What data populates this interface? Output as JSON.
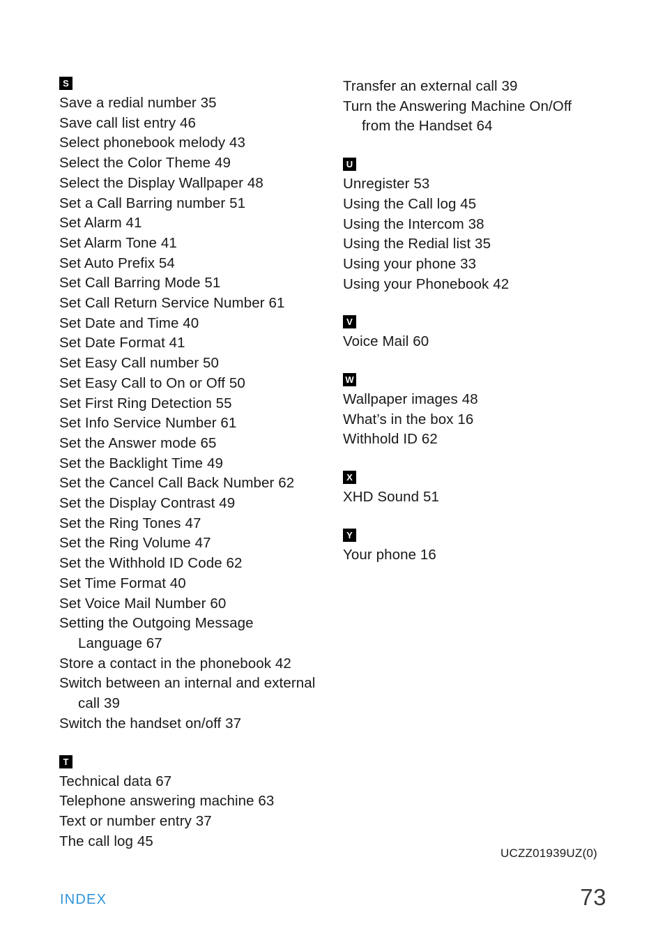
{
  "footer": {
    "section_label": "INDEX",
    "page_number": "73",
    "document_code": "UCZZ01939UZ(0)",
    "label_color": "#2f93d8"
  },
  "index": {
    "left_column": {
      "lead_entries": [],
      "sections": [
        {
          "letter": "S",
          "entries": [
            {
              "text": "Save a redial number 35"
            },
            {
              "text": "Save call list entry 46"
            },
            {
              "text": "Select phonebook melody 43"
            },
            {
              "text": "Select the Color Theme 49"
            },
            {
              "text": "Select the Display Wallpaper 48"
            },
            {
              "text": "Set a Call Barring number 51"
            },
            {
              "text": "Set Alarm 41"
            },
            {
              "text": "Set Alarm Tone 41"
            },
            {
              "text": "Set Auto Prefix 54"
            },
            {
              "text": "Set Call Barring Mode 51"
            },
            {
              "text": "Set Call Return Service Number 61"
            },
            {
              "text": "Set Date and Time 40"
            },
            {
              "text": "Set Date Format 41"
            },
            {
              "text": "Set Easy Call number 50"
            },
            {
              "text": "Set Easy Call to On or Off 50"
            },
            {
              "text": "Set First Ring Detection 55"
            },
            {
              "text": "Set Info Service Number 61"
            },
            {
              "text": "Set the Answer mode 65"
            },
            {
              "text": "Set the Backlight Time 49"
            },
            {
              "text": "Set the Cancel Call Back Number 62"
            },
            {
              "text": "Set the Display Contrast 49"
            },
            {
              "text": "Set the Ring Tones 47"
            },
            {
              "text": "Set the Ring Volume 47"
            },
            {
              "text": "Set the Withhold ID Code 62"
            },
            {
              "text": "Set Time Format 40"
            },
            {
              "text": "Set Voice Mail Number 60"
            },
            {
              "text": "Setting the Outgoing Message",
              "continuation": "Language 67"
            },
            {
              "text": "Store a contact in the phonebook 42"
            },
            {
              "text": "Switch between an internal and external",
              "continuation": "call 39"
            },
            {
              "text": "Switch the handset on/off 37"
            }
          ]
        },
        {
          "letter": "T",
          "entries": [
            {
              "text": "Technical data 67"
            },
            {
              "text": "Telephone answering machine 63"
            },
            {
              "text": "Text or number entry 37"
            },
            {
              "text": "The call log 45"
            }
          ]
        }
      ]
    },
    "right_column": {
      "lead_entries": [
        {
          "text": "Transfer an external call 39"
        },
        {
          "text": "Turn the Answering Machine On/Off",
          "continuation": "from the Handset 64"
        }
      ],
      "sections": [
        {
          "letter": "U",
          "entries": [
            {
              "text": "Unregister 53"
            },
            {
              "text": "Using the Call log 45"
            },
            {
              "text": "Using the Intercom 38"
            },
            {
              "text": "Using the Redial list 35"
            },
            {
              "text": "Using your phone 33"
            },
            {
              "text": "Using your Phonebook 42"
            }
          ]
        },
        {
          "letter": "V",
          "entries": [
            {
              "text": "Voice Mail 60"
            }
          ]
        },
        {
          "letter": "W",
          "entries": [
            {
              "text": "Wallpaper images 48"
            },
            {
              "text": "What’s in the box 16"
            },
            {
              "text": "Withhold ID 62"
            }
          ]
        },
        {
          "letter": "X",
          "entries": [
            {
              "text": "XHD Sound 51"
            }
          ]
        },
        {
          "letter": "Y",
          "entries": [
            {
              "text": "Your phone 16"
            }
          ]
        }
      ]
    }
  }
}
